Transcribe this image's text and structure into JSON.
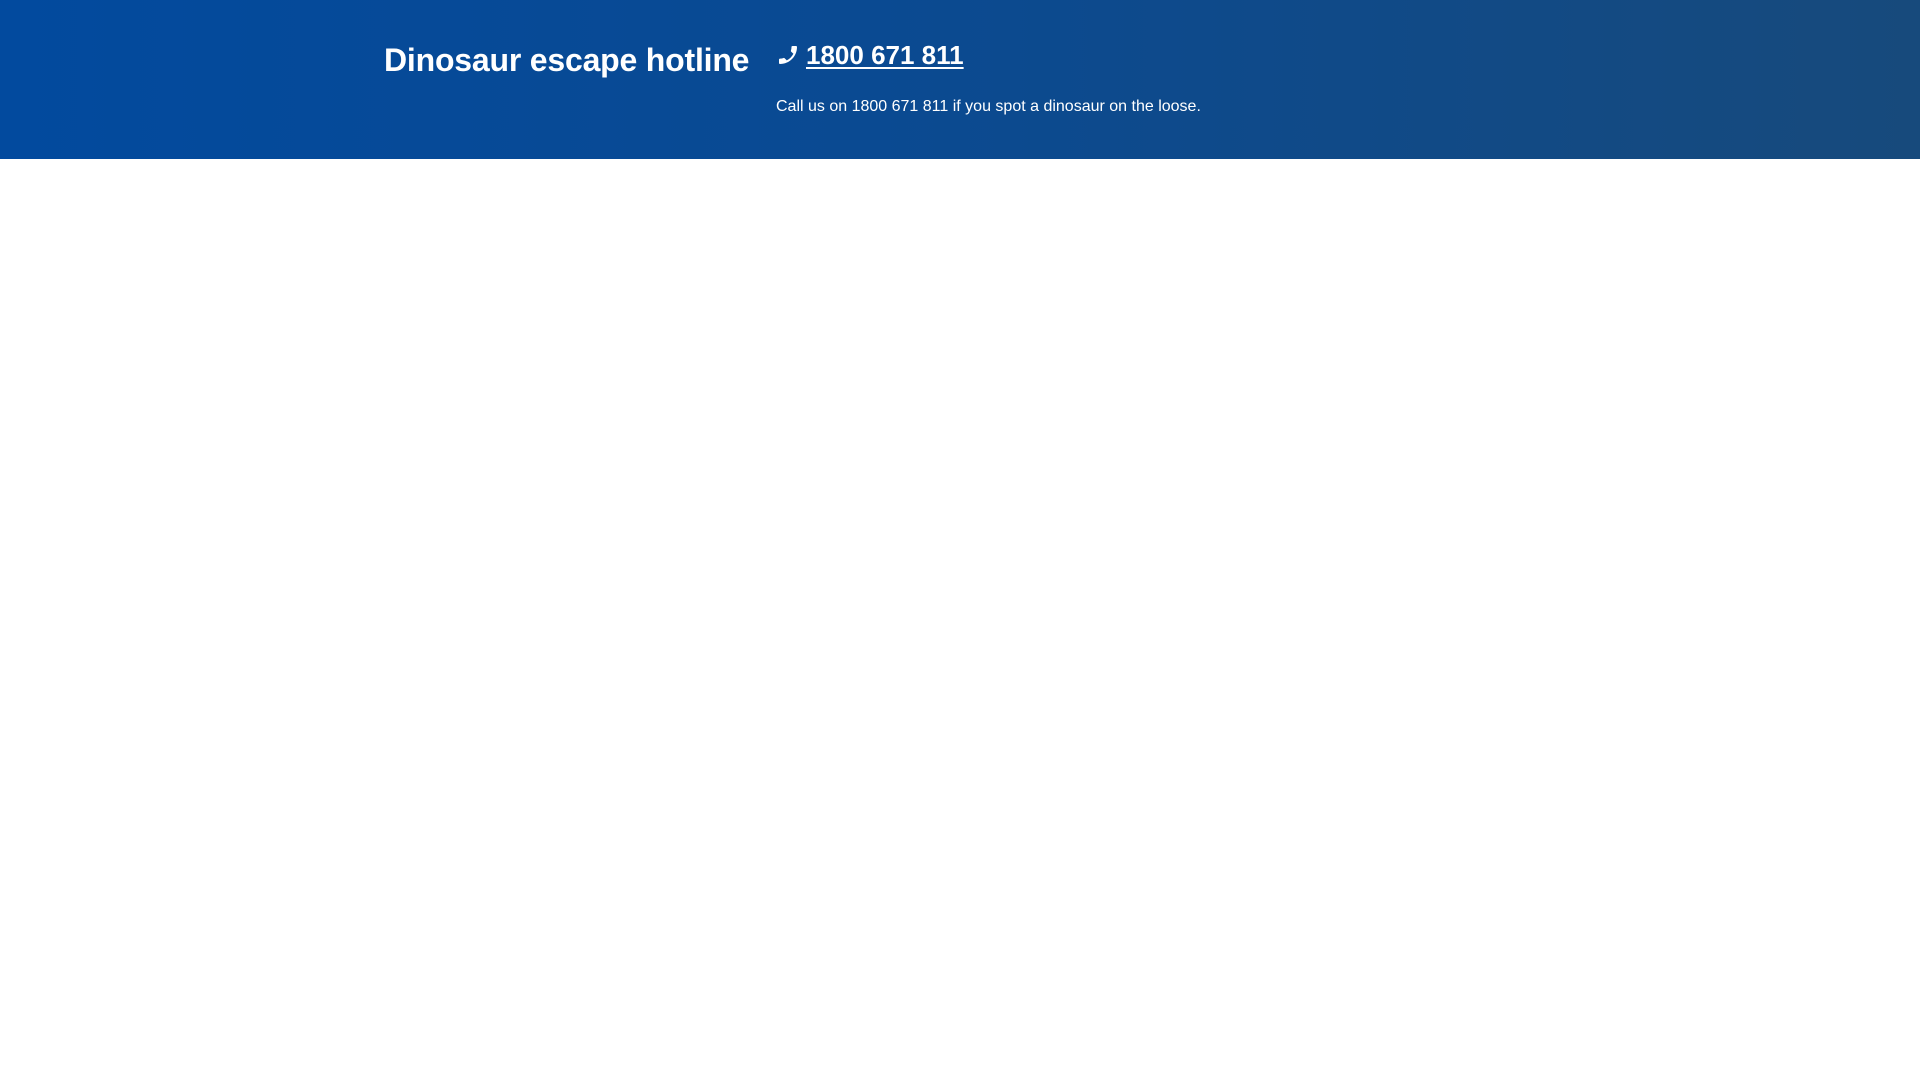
{
  "banner": {
    "title": "Dinosaur escape hotline",
    "phone_icon": "phone-icon",
    "phone_number": "1800 671 811",
    "description": "Call us on 1800 671 811 if you spot a dinosaur on the loose.",
    "colors": {
      "gradient_start": "#024a9e",
      "gradient_end": "#174a7c",
      "text": "#ffffff"
    }
  }
}
